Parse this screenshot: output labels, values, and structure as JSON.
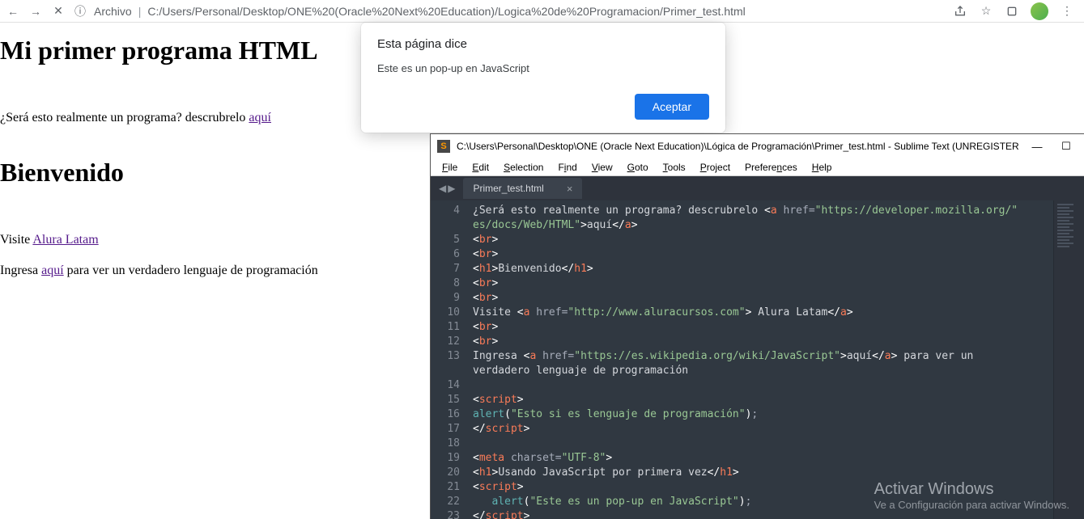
{
  "browser": {
    "scheme_label": "Archivo",
    "address": "C:/Users/Personal/Desktop/ONE%20(Oracle%20Next%20Education)/Logica%20de%20Programacion/Primer_test.html"
  },
  "page": {
    "h1_a": "Mi primer programa HTML",
    "para1_prefix": "¿Será esto realmente un programa? descrubrelo ",
    "para1_link": "aquí",
    "h1_b": "Bienvenido",
    "line_visite_prefix": "Visite ",
    "line_visite_link": "Alura Latam",
    "line_ingresa_prefix": "Ingresa ",
    "line_ingresa_link": "aquí",
    "line_ingresa_suffix": " para ver un verdadero lenguaje de programación"
  },
  "alert": {
    "title": "Esta página dice",
    "message": "Este es un pop-up en JavaScript",
    "ok": "Aceptar"
  },
  "sublime": {
    "title": "C:\\Users\\Personal\\Desktop\\ONE (Oracle Next Education)\\Lógica de Programación\\Primer_test.html - Sublime Text (UNREGISTERED)",
    "menus": [
      "File",
      "Edit",
      "Selection",
      "Find",
      "View",
      "Goto",
      "Tools",
      "Project",
      "Preferences",
      "Help"
    ],
    "tab": "Primer_test.html",
    "line_numbers": [
      "4",
      "",
      "5",
      "6",
      "7",
      "8",
      "9",
      "10",
      "11",
      "12",
      "13",
      "",
      "14",
      "15",
      "16",
      "17",
      "18",
      "19",
      "20",
      "21",
      "22",
      "23"
    ],
    "code": {
      "l4a": "¿Será esto realmente un programa? descrubrelo ",
      "l4_href": "https://developer.mozilla.org/es/docs/Web/HTML",
      "l4_link": "aquí",
      "l7_text": "Bienvenido",
      "l10_prefix": "Visite ",
      "l10_href": "http://www.aluracursos.com",
      "l10_link": " Alura Latam",
      "l13_prefix": "Ingresa ",
      "l13_href": "https://es.wikipedia.org/wiki/JavaScript",
      "l13_link": "aquí",
      "l13_suffix": " para ver un verdadero lenguaje de programación",
      "l16_alert": "Esto si es lenguaje de programación",
      "l19_charset": "UTF-8",
      "l20_text": "Usando JavaScript por primera vez",
      "l22_alert": "Este es un pop-up en JavaScript"
    }
  },
  "watermark": {
    "line1": "Activar Windows",
    "line2": "Ve a Configuración para activar Windows."
  }
}
